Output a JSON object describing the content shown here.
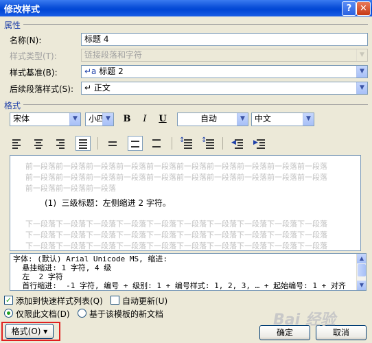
{
  "window": {
    "title": "修改样式",
    "help_label": "?",
    "close_label": "✕"
  },
  "properties": {
    "section_label": "属性",
    "name_label": "名称(N):",
    "name_value": "标题 4",
    "style_type_label": "样式类型(T):",
    "style_type_value": "链接段落和字符",
    "based_on_label": "样式基准(B):",
    "based_on_icon": "↵a",
    "based_on_value": "标题 2",
    "next_style_label": "后续段落样式(S):",
    "next_style_icon": "↵",
    "next_style_value": "正文"
  },
  "format": {
    "section_label": "格式",
    "font": "宋体",
    "size": "小四",
    "bold": "B",
    "italic": "I",
    "underline": "U",
    "color": "自动",
    "script": "中文"
  },
  "preview": {
    "prev_lines": [
      "前一段落前一段落前一段落前一段落前一段落前一段落前一段落前一段落前一段落前一段落",
      "前一段落前一段落前一段落前一段落前一段落前一段落前一段落前一段落前一段落前一段落",
      "前一段落前一段落前一段落"
    ],
    "sample": "(1)  三级标题：左侧缩进 2 字符。",
    "next_lines": [
      "下一段落下一段落下一段落下一段落下一段落下一段落下一段落下一段落下一段落下一段落",
      "下一段落下一段落下一段落下一段落下一段落下一段落下一段落下一段落下一段落下一段落",
      "下一段落下一段落下一段落下一段落下一段落下一段落下一段落下一段落下一段落下一段落"
    ]
  },
  "description": {
    "lines": [
      "字体: (默认) Arial Unicode MS, 缩进:",
      "  悬挂缩进: 1 字符, 4 级",
      "  左  2 字符",
      "  首行缩进:  -1 字符, 编号 + 级别: 1 + 编号样式: 1, 2, 3, … + 起始编号: 1 + 对齐"
    ]
  },
  "options": {
    "add_quick_label": "添加到快速样式列表(Q)",
    "add_quick_checked": true,
    "auto_update_label": "自动更新(U)",
    "auto_update_checked": false,
    "only_doc_label": "仅限此文档(D)",
    "template_label": "基于该模板的新文档"
  },
  "buttons": {
    "format": "格式(O) ▾",
    "ok": "确定",
    "cancel": "取消"
  },
  "watermark": "Bai 经验"
}
